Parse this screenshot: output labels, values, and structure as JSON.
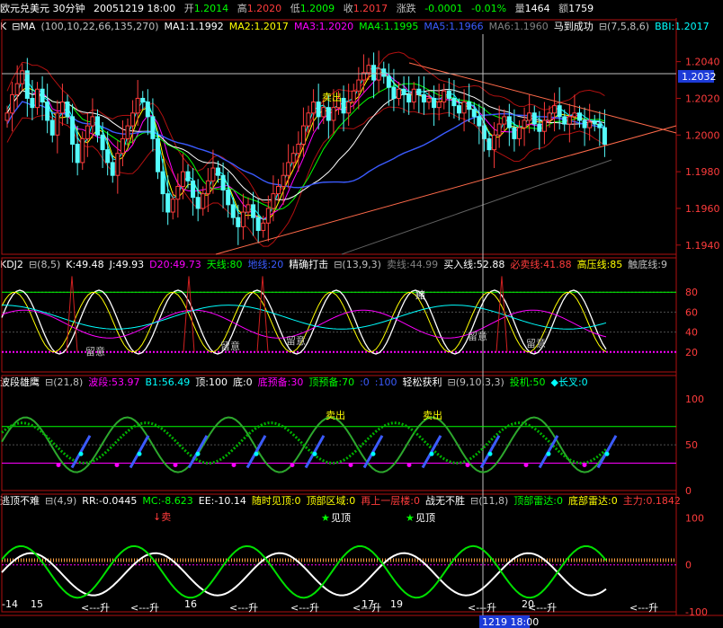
{
  "title_bar": {
    "name": "欧元兑美元 30分钟",
    "datetime": "20051219 18:00",
    "open_label": "开",
    "open": "1.2014",
    "high_label": "高",
    "high": "1.2020",
    "low_label": "低",
    "low": "1.2009",
    "close_label": "收",
    "close": "1.2017",
    "change_label": "涨跌",
    "change": "-0.0001",
    "change_pct": "-0.01%",
    "volume_label": "量",
    "volume": "1464",
    "amount_label": "额",
    "amount": "1759"
  },
  "panes": [
    {
      "id": "main",
      "header": [
        {
          "text": "K",
          "color": "#ffffff"
        },
        {
          "text": "⊟MA",
          "color": "#ffffff"
        },
        {
          "text": "(100,10,22,66,135,270)",
          "color": "#c0c0c0"
        },
        {
          "text": "MA1:1.1992",
          "color": "#ffffff"
        },
        {
          "text": "MA2:1.2017",
          "color": "#ffff00"
        },
        {
          "text": "MA3:1.2020",
          "color": "#ff00ff"
        },
        {
          "text": "MA4:1.1995",
          "color": "#00ff00"
        },
        {
          "text": "MA5:1.1966",
          "color": "#3b5bff"
        },
        {
          "text": "MA6:1.1960",
          "color": "#808080"
        },
        {
          "text": "马到成功",
          "color": "#ffffff"
        },
        {
          "text": "⊟(7,5,8,6)",
          "color": "#c0c0c0"
        },
        {
          "text": "BBI:1.2017",
          "color": "#00ffff"
        }
      ],
      "y_ticks": [
        "1.2040",
        "1.2020",
        "1.2000",
        "1.1980",
        "1.1960",
        "1.1940"
      ],
      "price_tag": "1.2032",
      "annotations": [
        "卖出"
      ]
    },
    {
      "id": "kdj",
      "header": [
        {
          "text": "KDJ2",
          "color": "#ffffff"
        },
        {
          "text": "⊟(8,5)",
          "color": "#c0c0c0"
        },
        {
          "text": "K:49.48",
          "color": "#ffffff"
        },
        {
          "text": "J:49.93",
          "color": "#ffffff"
        },
        {
          "text": "D20:49.73",
          "color": "#ff00ff"
        },
        {
          "text": "天线:80",
          "color": "#00ff00"
        },
        {
          "text": "地线:20",
          "color": "#3b5bff"
        },
        {
          "text": "精确打击",
          "color": "#ffffff"
        },
        {
          "text": "⊟(13,9,3)",
          "color": "#c0c0c0"
        },
        {
          "text": "卖线:44.99",
          "color": "#808080"
        },
        {
          "text": "买入线:52.88",
          "color": "#ffffff"
        },
        {
          "text": "必卖线:41.88",
          "color": "#ff3c3c"
        },
        {
          "text": "高压线:85",
          "color": "#ffff00"
        },
        {
          "text": "触底线:9",
          "color": "#c0c0c0"
        }
      ],
      "y_ticks": [
        "80",
        "60",
        "40",
        "20"
      ],
      "annotations": [
        "留意",
        "留意",
        "留意",
        "留意",
        "留意",
        "留意",
        "赌"
      ]
    },
    {
      "id": "wave",
      "header": [
        {
          "text": "波段雄鹰",
          "color": "#ffffff"
        },
        {
          "text": "⊟(21,8)",
          "color": "#c0c0c0"
        },
        {
          "text": "波段:53.97",
          "color": "#ff00ff"
        },
        {
          "text": "B1:56.49",
          "color": "#00ffff"
        },
        {
          "text": "顶:100",
          "color": "#ffffff"
        },
        {
          "text": "底:0",
          "color": "#ffffff"
        },
        {
          "text": "底预备:30",
          "color": "#ff00ff"
        },
        {
          "text": "顶预备:70",
          "color": "#00ff00"
        },
        {
          "text": ":0",
          "color": "#3b5bff"
        },
        {
          "text": ":100",
          "color": "#3b5bff"
        },
        {
          "text": "轻松获利",
          "color": "#ffffff"
        },
        {
          "text": "⊟(9,10,3,3)",
          "color": "#c0c0c0"
        },
        {
          "text": "投机:50",
          "color": "#00ff00"
        },
        {
          "text": "◆长叉:0",
          "color": "#00ffff"
        }
      ],
      "y_ticks": [
        "100",
        "50",
        "0"
      ],
      "annotations": [
        "卖出",
        "卖出"
      ]
    },
    {
      "id": "escape",
      "header": [
        {
          "text": "逃顶不难",
          "color": "#ffffff"
        },
        {
          "text": "⊟(4,9)",
          "color": "#c0c0c0"
        },
        {
          "text": "RR:-0.0445",
          "color": "#ffffff"
        },
        {
          "text": "MC:-8.623",
          "color": "#00ff00"
        },
        {
          "text": "EE:-10.14",
          "color": "#ffffff"
        },
        {
          "text": "随时见顶:0",
          "color": "#ffff00"
        },
        {
          "text": "顶部区域:0",
          "color": "#ffff00"
        },
        {
          "text": "再上一层楼:0",
          "color": "#ff3c3c"
        },
        {
          "text": "战无不胜",
          "color": "#ffffff"
        },
        {
          "text": "⊟(11,8)",
          "color": "#c0c0c0"
        },
        {
          "text": "顶部雷达:0",
          "color": "#00ff00"
        },
        {
          "text": "底部雷达:0",
          "color": "#ffff00"
        },
        {
          "text": "主力:0.1842",
          "color": "#ff3c3c"
        }
      ],
      "y_ticks": [
        "100",
        "0",
        "-100"
      ],
      "annotations": [
        "↓卖",
        "见顶",
        "见顶",
        "<---升",
        "<---升",
        "<---升",
        "<---升",
        "<---升",
        "<---升",
        "<---升",
        "<---升"
      ]
    }
  ],
  "x_axis": {
    "labels": [
      "-14",
      "15",
      "16",
      "17",
      "19",
      "20"
    ],
    "cursor_label": "1219 18:00"
  },
  "chart_data": {
    "type": "candlestick",
    "symbol": "欧元兑美元",
    "interval": "30分钟",
    "ylim": [
      1.1935,
      1.2055
    ],
    "x_labels": [
      "-14",
      "15",
      "16",
      "17",
      "19",
      "20"
    ],
    "close": [
      1.2012,
      1.2022,
      1.2028,
      1.2035,
      1.202,
      1.2015,
      1.2025,
      1.2018,
      1.2008,
      1.2,
      1.2012,
      1.2018,
      1.201,
      1.1995,
      1.1985,
      1.1998,
      1.2005,
      1.201,
      1.2,
      1.1992,
      1.1985,
      1.1978,
      1.199,
      1.1998,
      1.2005,
      1.2012,
      1.202,
      1.2018,
      1.201,
      1.1998,
      1.198,
      1.1968,
      1.1958,
      1.1965,
      1.1972,
      1.198,
      1.1975,
      1.1966,
      1.196,
      1.1968,
      1.1975,
      1.1982,
      1.1978,
      1.197,
      1.1962,
      1.1955,
      1.195,
      1.1958,
      1.1962,
      1.1955,
      1.1948,
      1.1952,
      1.196,
      1.1968,
      1.1972,
      1.1978,
      1.1985,
      1.199,
      1.1995,
      1.2005,
      1.2012,
      1.2018,
      1.201,
      1.2015,
      1.2008,
      1.2015,
      1.202,
      1.2012,
      1.2018,
      1.2024,
      1.203,
      1.2034,
      1.2038,
      1.203,
      1.2036,
      1.2032,
      1.2026,
      1.202,
      1.2025,
      1.2022,
      1.2018,
      1.2025,
      1.2022,
      1.2018,
      1.202,
      1.2015,
      1.2018,
      1.2024,
      1.202,
      1.2016,
      1.2012,
      1.2018,
      1.2014,
      1.201,
      1.2005,
      1.1998,
      1.1992,
      1.2,
      1.2006,
      1.201,
      1.2004,
      1.1998,
      1.2004,
      1.2008,
      1.2012,
      1.2006,
      1.2002,
      1.2008,
      1.2012,
      1.2016,
      1.201,
      1.2006,
      1.201,
      1.2012,
      1.2008,
      1.2004,
      1.2007,
      1.2006,
      1.2004,
      1.1995
    ]
  }
}
